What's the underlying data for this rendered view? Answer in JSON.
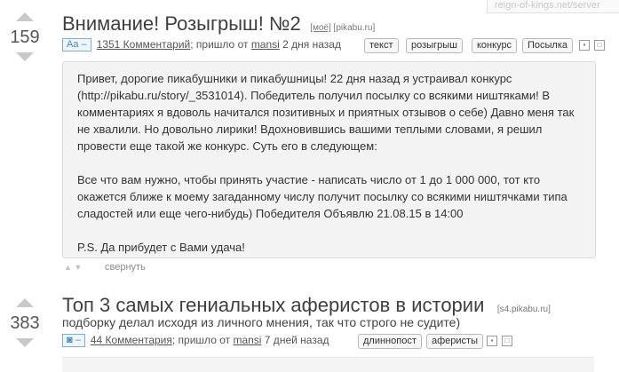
{
  "corner_label": "reign-of-kings.net/server",
  "post1": {
    "rating": "159",
    "title": "Внимание! Розыгрыш! №2",
    "source_mine": "[моё]",
    "source": "[pikabu.ru]",
    "type_badge": "Aa –",
    "comments": "1351 Комментарий",
    "posted_prefix": "; пришло от ",
    "author": "mansi",
    "posted_time": " 2 дня назад",
    "tags": [
      "текст",
      "розыгрыш",
      "конкурс",
      "Посылка"
    ],
    "body": [
      "Привет, дорогие пикабушники и пикабушницы! 22 дня назад я устраивал конкурс",
      "(http://pikabu.ru/story/_3531014). Победитель получил посылку со всякими ништяками! В",
      "комментариях я вдоволь начитался позитивных и приятных отзывов о себе) Давно меня так",
      "не хвалили. Но довольно лирики! Вдохновившись вашими теплыми словами, я решил",
      "провести еще такой же конкурс. Суть его в следующем:",
      "",
      "Все что вам нужно, чтобы принять участие - написать число от 1 до 1 000 000, тот кто",
      "окажется ближе к моему загаданному числу получит посылку со всякими ништячками типа",
      "сладостей или еще чего-нибудь) Победителя Объявлю 21.08.15 в 14:00",
      "",
      "P.S. Да прибудет с Вами удача!"
    ],
    "collapse_label": "свернуть"
  },
  "post2": {
    "rating": "383",
    "title": "Топ 3 самых гениальных аферистов в истории",
    "source": "[s4.pikabu.ru]",
    "subtitle": "подборку делал исходя из личного мнения, так что строго не судите)",
    "type_badge": "◙ –",
    "comments": "44 Комментария",
    "posted_prefix": "; пришло от ",
    "author": "mansi",
    "posted_time": " 7 дней назад",
    "tags": [
      "длиннопост",
      "аферисты"
    ]
  }
}
